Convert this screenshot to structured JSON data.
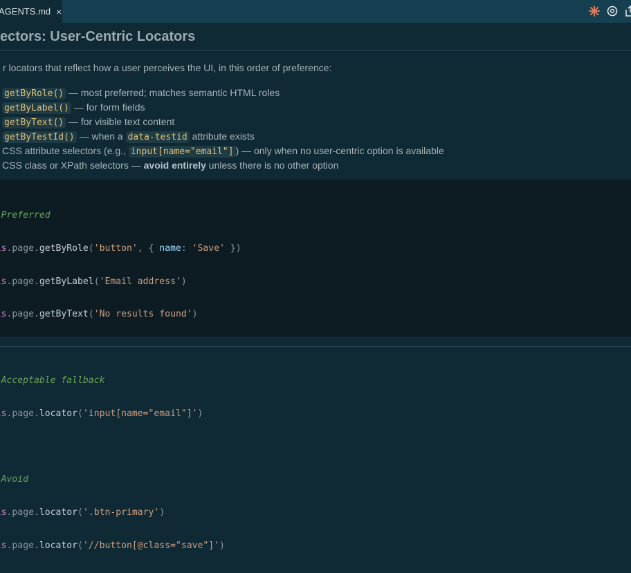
{
  "tab": {
    "name": "AGENTS.md",
    "close": "×"
  },
  "toolbar": {
    "icons": [
      "claude-icon",
      "openai-icon",
      "share-icon"
    ]
  },
  "heading": "ectors: User-Centric Locators",
  "intro": "r locators that reflect how a user perceives the UI, in this order of preference:",
  "list": [
    {
      "code": "getByRole()",
      "text": " — most preferred; matches semantic HTML roles"
    },
    {
      "code": "getByLabel()",
      "text": " — for form fields"
    },
    {
      "code": "getByText()",
      "text": " — for visible text content"
    },
    {
      "code": "getByTestId()",
      "text": " — when a ",
      "code2": "data-testid",
      "text2": " attribute exists"
    },
    {
      "pre": "CSS attribute selectors (e.g., ",
      "code": "input[name=\"email\"]",
      "text": ") — only when no user-centric option is available"
    },
    {
      "pre": "CSS class or XPath selectors — ",
      "bold": "avoid entirely",
      "text": " unless there is no other option"
    }
  ],
  "code": {
    "c1": "// Preferred",
    "c2": "// Acceptable fallback",
    "c3": "// Avoid",
    "this": "this",
    "page": ".page.",
    "l1": {
      "fn": "getByRole",
      "a": "'button'",
      "b": "name",
      "c": "'Save'"
    },
    "l2": {
      "fn": "getByLabel",
      "a": "'Email address'"
    },
    "l3": {
      "fn": "getByText",
      "a": "'No results found'"
    },
    "l4": {
      "fn": "locator",
      "a": "'input[name=\"email\"]'"
    },
    "l5": {
      "fn": "locator",
      "a": "'.btn-primary'"
    },
    "l6": {
      "fn": "locator",
      "a": "'//button[@class=\"save\"]'"
    }
  }
}
